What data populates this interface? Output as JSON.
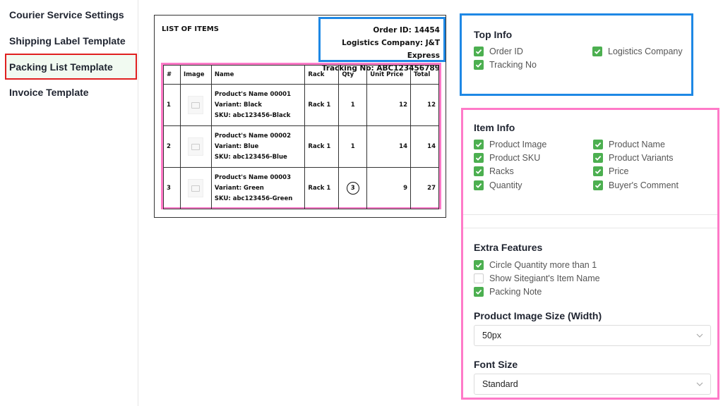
{
  "sidebar": {
    "items": [
      {
        "label": "Courier Service Settings"
      },
      {
        "label": "Shipping Label Template"
      },
      {
        "label": "Packing List Template"
      },
      {
        "label": "Invoice Template"
      }
    ]
  },
  "preview": {
    "title": "LIST OF ITEMS",
    "top_info": {
      "order_id": "Order ID: 14454",
      "logistics": "Logistics Company: J&T Express",
      "tracking": "Tracking No: ABC123456789"
    },
    "table": {
      "headers": [
        "#",
        "Image",
        "Name",
        "Rack",
        "Qty",
        "Unit Price",
        "Total"
      ],
      "rows": [
        {
          "num": "1",
          "name": "Product's Name 00001",
          "variant": "Variant: Black",
          "sku": "SKU: abc123456-Black",
          "rack": "Rack 1",
          "qty": "1",
          "price": "12",
          "total": "12"
        },
        {
          "num": "2",
          "name": "Product's Name 00002",
          "variant": "Variant: Blue",
          "sku": "SKU: abc123456-Blue",
          "rack": "Rack 1",
          "qty": "1",
          "price": "14",
          "total": "14"
        },
        {
          "num": "3",
          "name": "Product's Name 00003",
          "variant": "Variant: Green",
          "sku": "SKU: abc123456-Green",
          "rack": "Rack 1",
          "qty": "3",
          "price": "9",
          "total": "27"
        }
      ]
    }
  },
  "top_info_panel": {
    "title": "Top Info",
    "options": [
      {
        "label": "Order ID",
        "checked": true
      },
      {
        "label": "Logistics Company",
        "checked": true
      },
      {
        "label": "Tracking No",
        "checked": true
      }
    ]
  },
  "item_info_panel": {
    "title": "Item Info",
    "options": [
      {
        "label": "Product Image",
        "checked": true
      },
      {
        "label": "Product Name",
        "checked": true
      },
      {
        "label": "Product SKU",
        "checked": true
      },
      {
        "label": "Product Variants",
        "checked": true
      },
      {
        "label": "Racks",
        "checked": true
      },
      {
        "label": "Price",
        "checked": true
      },
      {
        "label": "Quantity",
        "checked": true
      },
      {
        "label": "Buyer's Comment",
        "checked": true
      }
    ]
  },
  "extra_features": {
    "title": "Extra Features",
    "options": [
      {
        "label": "Circle Quantity more than 1",
        "checked": true
      },
      {
        "label": "Show Sitegiant's Item Name",
        "checked": false
      },
      {
        "label": "Packing Note",
        "checked": true
      }
    ]
  },
  "image_size": {
    "title": "Product Image Size (Width)",
    "value": "50px"
  },
  "font_size": {
    "title": "Font Size",
    "value": "Standard"
  },
  "colors": {
    "accent_green": "#4caf50",
    "highlight_red": "#e02020",
    "highlight_blue": "#1e88e5",
    "highlight_pink": "#ff7ac8"
  },
  "icons": {
    "check": "check-icon",
    "chevron": "chevron-down-icon",
    "image_placeholder": "image-placeholder-icon"
  }
}
